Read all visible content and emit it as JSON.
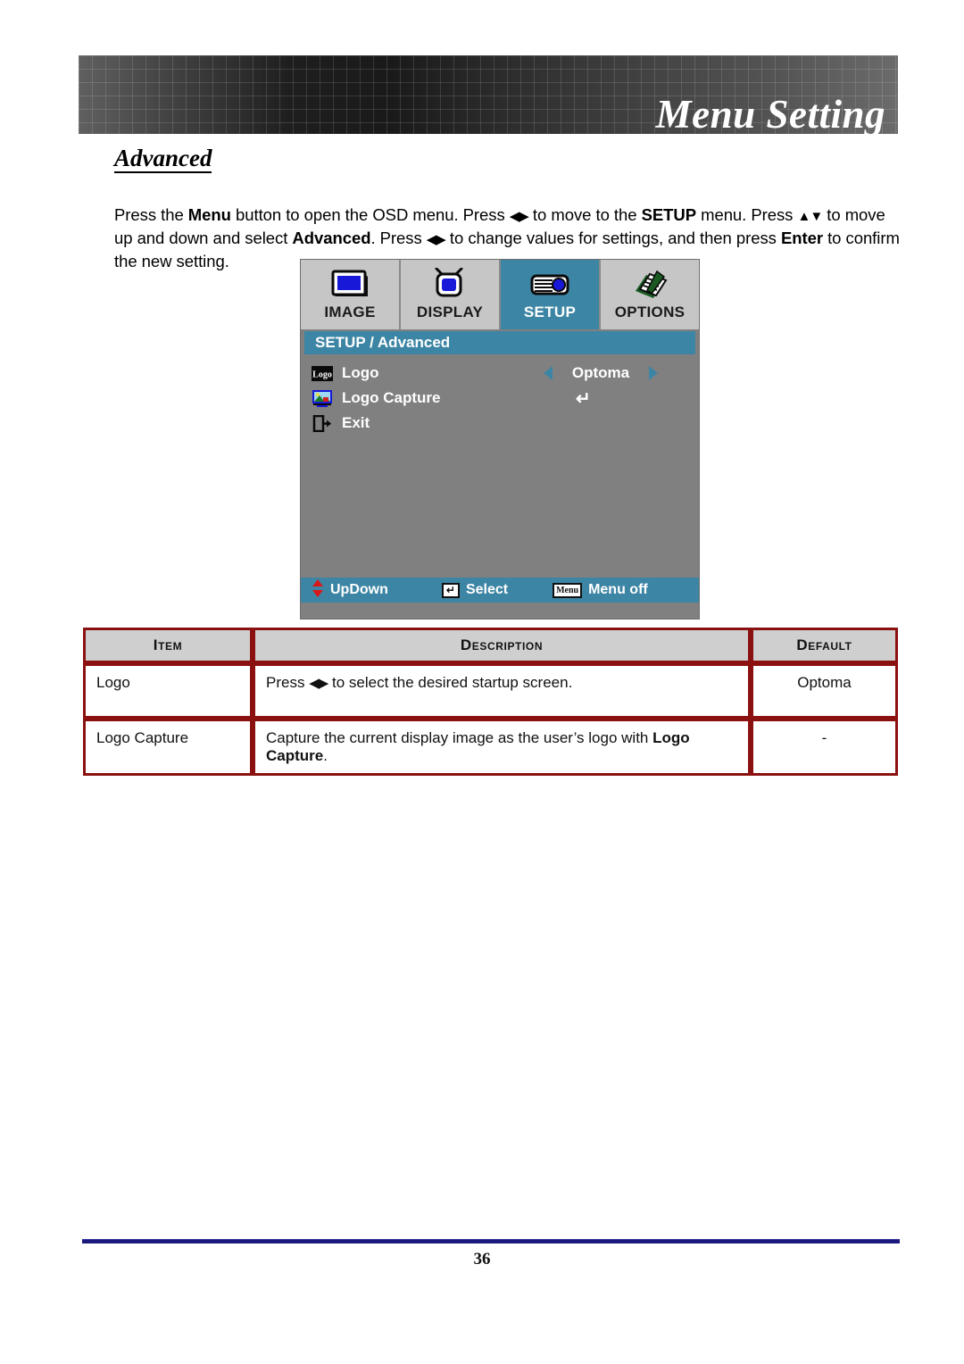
{
  "banner": {
    "title": "Menu Setting"
  },
  "section": {
    "heading": "Advanced"
  },
  "intro": {
    "part1": "Press the ",
    "b1": "Menu",
    "part2": " button to open the OSD menu. Press ",
    "arrows1": "◀▶",
    "part3": " to move to the ",
    "b2": "SETUP",
    "part4": " menu. Press ",
    "arrows2": "▲▼",
    "part5": " to move up and down and select ",
    "b3": "Advanced",
    "part6": ". Press ",
    "arrows3": "◀▶",
    "part7": " to change values for settings, and then press ",
    "b4": "Enter",
    "part8": " to confirm the new setting."
  },
  "osd": {
    "tabs": [
      {
        "label": "IMAGE",
        "icon": "monitor-icon",
        "active": false
      },
      {
        "label": "DISPLAY",
        "icon": "tv-icon",
        "active": false
      },
      {
        "label": "SETUP",
        "icon": "projector-icon",
        "active": true
      },
      {
        "label": "OPTIONS",
        "icon": "document-pencil-icon",
        "active": false
      }
    ],
    "breadcrumb": "SETUP / Advanced",
    "rows": [
      {
        "label": "Logo",
        "icon": "logo-box-icon",
        "value": "Optoma",
        "control": "arrows"
      },
      {
        "label": "Logo Capture",
        "icon": "logo-capture-icon",
        "value": "↵",
        "control": "enter"
      },
      {
        "label": "Exit",
        "icon": "exit-door-icon",
        "value": "",
        "control": "none"
      }
    ],
    "footer": [
      {
        "key_icon": "up-down-arrows-icon",
        "label": "UpDown"
      },
      {
        "key_icon": "enter-key-icon",
        "label": "Select"
      },
      {
        "key_icon": "menu-key-icon",
        "key_text": "Menu",
        "label": "Menu off"
      }
    ]
  },
  "table": {
    "headers": [
      "Item",
      "Description",
      "Default"
    ],
    "rows": [
      {
        "item": "Logo",
        "desc_pre": "Press ",
        "desc_arrows": "◀▶",
        "desc_post": " to select the desired startup screen.",
        "desc_bold": "",
        "desc_tail": "",
        "default": "Optoma"
      },
      {
        "item": "Logo Capture",
        "desc_pre": "Capture the current display image as the user’s logo with ",
        "desc_arrows": "",
        "desc_post": "",
        "desc_bold": "Logo Capture",
        "desc_tail": ".",
        "default": "-"
      }
    ]
  },
  "footer": {
    "page_number": "36"
  },
  "colors": {
    "osd_panel": "#808080",
    "osd_accent": "#3d85a4",
    "osd_tab": "#c6c6c6",
    "table_border": "#8b1111",
    "table_header": "#cfcfcf",
    "footer_rule": "#1a1a7a",
    "icon_blue": "#1818d8",
    "red_arrow": "#d81818"
  }
}
